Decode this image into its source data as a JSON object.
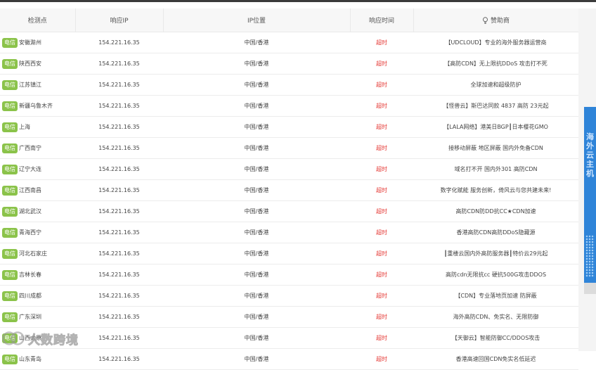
{
  "headers": {
    "node": "检测点",
    "ip": "响应IP",
    "location": "IP位置",
    "time": "响应时间",
    "sponsor": "赞助商"
  },
  "rows": [
    {
      "isp": "电信",
      "node": "安徽滁州",
      "ip": "154.221.16.35",
      "location": "中国/香港",
      "time": "超时",
      "sponsor": "【UDCLOUD】专业的海外服务器运营商"
    },
    {
      "isp": "电信",
      "node": "陕西西安",
      "ip": "154.221.16.35",
      "location": "中国/香港",
      "time": "超时",
      "sponsor": "【高防CDN】无上限抗DDoS 攻击打不死"
    },
    {
      "isp": "电信",
      "node": "江苏镇江",
      "ip": "154.221.16.35",
      "location": "中国/香港",
      "time": "超时",
      "sponsor": "全球加速和超级防护"
    },
    {
      "isp": "电信",
      "node": "新疆乌鲁木齐",
      "ip": "154.221.16.35",
      "location": "中国/香港",
      "time": "超时",
      "sponsor": "【怪兽云】斯巴达同款 4837 高防 23元起"
    },
    {
      "isp": "电信",
      "node": "上海",
      "ip": "154.221.16.35",
      "location": "中国/香港",
      "time": "超时",
      "sponsor": "【LALA网络】港美日BGP┃日本樱花GMO"
    },
    {
      "isp": "电信",
      "node": "广西南宁",
      "ip": "154.221.16.35",
      "location": "中国/香港",
      "time": "超时",
      "sponsor": "接移动屏蔽 地区屏蔽 国内外免备CDN"
    },
    {
      "isp": "电信",
      "node": "辽宁大连",
      "ip": "154.221.16.35",
      "location": "中国/香港",
      "time": "超时",
      "sponsor": "域名打不开 国内外301 高防CDN"
    },
    {
      "isp": "电信",
      "node": "江西南昌",
      "ip": "154.221.16.35",
      "location": "中国/香港",
      "time": "超时",
      "sponsor": "数字化赋能 服务创新，倚风云与您共建未来!"
    },
    {
      "isp": "电信",
      "node": "湖北武汉",
      "ip": "154.221.16.35",
      "location": "中国/香港",
      "time": "超时",
      "sponsor": "高防CDN防DD抗CC★CDN加速"
    },
    {
      "isp": "电信",
      "node": "青海西宁",
      "ip": "154.221.16.35",
      "location": "中国/香港",
      "time": "超时",
      "sponsor": "香港高防CDN高防DDoS隐藏源"
    },
    {
      "isp": "电信",
      "node": "河北石家庄",
      "ip": "154.221.16.35",
      "location": "中国/香港",
      "time": "超时",
      "sponsor": "┃重楼云国内外高防服务器┃特价云29元起"
    },
    {
      "isp": "电信",
      "node": "吉林长春",
      "ip": "154.221.16.35",
      "location": "中国/香港",
      "time": "超时",
      "sponsor": "高防cdn无限抗cc 硬抗500G攻击DDOS"
    },
    {
      "isp": "电信",
      "node": "四川成都",
      "ip": "154.221.16.35",
      "location": "中国/香港",
      "time": "超时",
      "sponsor": "【CDN】专业落地页加速 防屏蔽"
    },
    {
      "isp": "电信",
      "node": "广东深圳",
      "ip": "154.221.16.35",
      "location": "中国/香港",
      "time": "超时",
      "sponsor": "海外高防CDN、免实名、无限防御"
    },
    {
      "isp": "电信",
      "node": "山西太原",
      "ip": "154.221.16.35",
      "location": "中国/香港",
      "time": "超时",
      "sponsor": "【天御云】智能防御CC/DDOS攻击"
    },
    {
      "isp": "电信",
      "node": "山东青岛",
      "ip": "154.221.16.35",
      "location": "中国/香港",
      "time": "超时",
      "sponsor": "香港高速回国CDN免实名低延迟"
    }
  ],
  "ad": {
    "text": "海外云主机"
  },
  "watermark": {
    "text": "大数跨境"
  },
  "colors": {
    "badge": "#8bc34a",
    "timeout": "#e53935",
    "ad": "#2f84d8"
  }
}
